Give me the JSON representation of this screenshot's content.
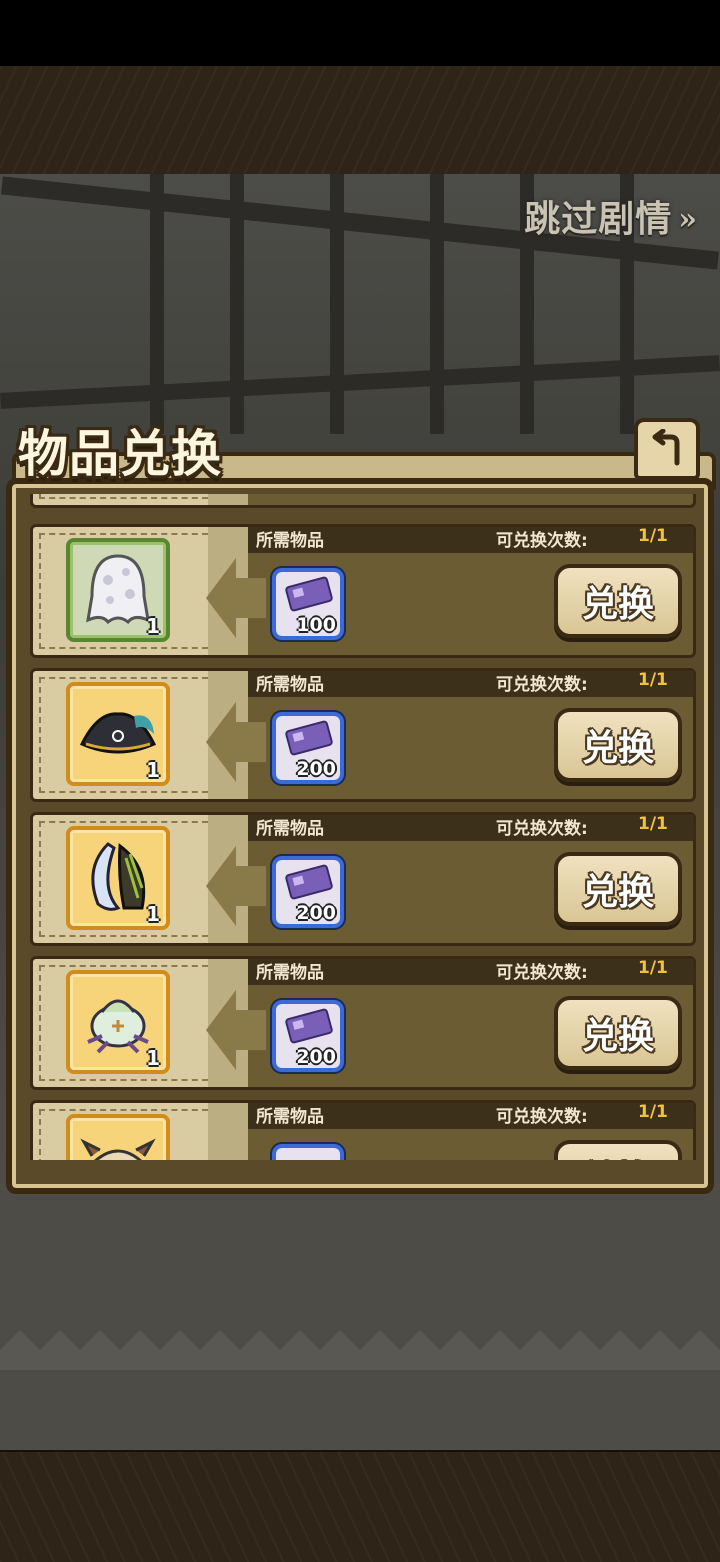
{
  "header": {
    "skip_label": "跳过剧情",
    "skip_arrow": "»"
  },
  "panel": {
    "title": "物品兑换"
  },
  "row_labels": {
    "required": "所需物品",
    "limit": "可兑换次数:",
    "exchange": "兑换"
  },
  "rows": [
    {
      "icon": "ghost-egg-icon",
      "item_qty": "1",
      "cost": "100",
      "limit": "1/1",
      "frame": "green"
    },
    {
      "icon": "pirate-hat-icon",
      "item_qty": "1",
      "cost": "200",
      "limit": "1/1",
      "frame": "gold"
    },
    {
      "icon": "feather-wing-icon",
      "item_qty": "1",
      "cost": "200",
      "limit": "1/1",
      "frame": "gold"
    },
    {
      "icon": "cabbage-creature-icon",
      "item_qty": "1",
      "cost": "200",
      "limit": "1/1",
      "frame": "gold"
    },
    {
      "icon": "horned-mask-icon",
      "item_qty": "",
      "cost": "",
      "limit": "1/1",
      "frame": "gold"
    }
  ],
  "colors": {
    "limit_value": "#f2c33a",
    "ticket_border": "#3b6bd6",
    "gold_frame": "#d28c1a",
    "green_frame": "#59862f"
  }
}
